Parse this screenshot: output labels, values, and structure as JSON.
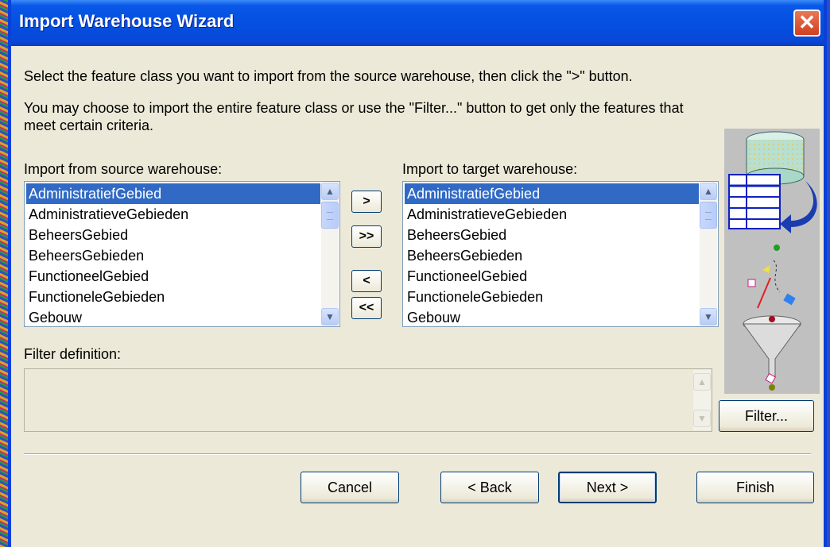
{
  "window": {
    "title": "Import Warehouse Wizard",
    "close_label": "✕"
  },
  "instructions": {
    "line1": "Select the feature class you want to import from the source warehouse,  then click the \">\" button.",
    "line2": "You may choose to import the entire feature class or use the \"Filter...\" button to get only the features that",
    "line3": "meet certain criteria."
  },
  "source": {
    "label": "Import from source warehouse:",
    "items": [
      "AdministratiefGebied",
      "AdministratieveGebieden",
      "BeheersGebied",
      "BeheersGebieden",
      "FunctioneelGebied",
      "FunctioneleGebieden",
      "Gebouw"
    ],
    "selected": "AdministratiefGebied"
  },
  "target": {
    "label": "Import to target warehouse:",
    "items": [
      "AdministratiefGebied",
      "AdministratieveGebieden",
      "BeheersGebied",
      "BeheersGebieden",
      "FunctioneelGebied",
      "FunctioneleGebieden",
      "Gebouw"
    ],
    "selected": "AdministratiefGebied"
  },
  "move_buttons": {
    "add": ">",
    "add_all": ">>",
    "remove": "<",
    "remove_all": "<<"
  },
  "filter": {
    "label": "Filter definition:",
    "value": "",
    "button": "Filter..."
  },
  "footer": {
    "cancel": "Cancel",
    "back": "< Back",
    "next": "Next >",
    "finish": "Finish"
  },
  "icons": {
    "scroll_up": "▲",
    "scroll_down": "▼",
    "illustration": "database-filter-illustration"
  }
}
